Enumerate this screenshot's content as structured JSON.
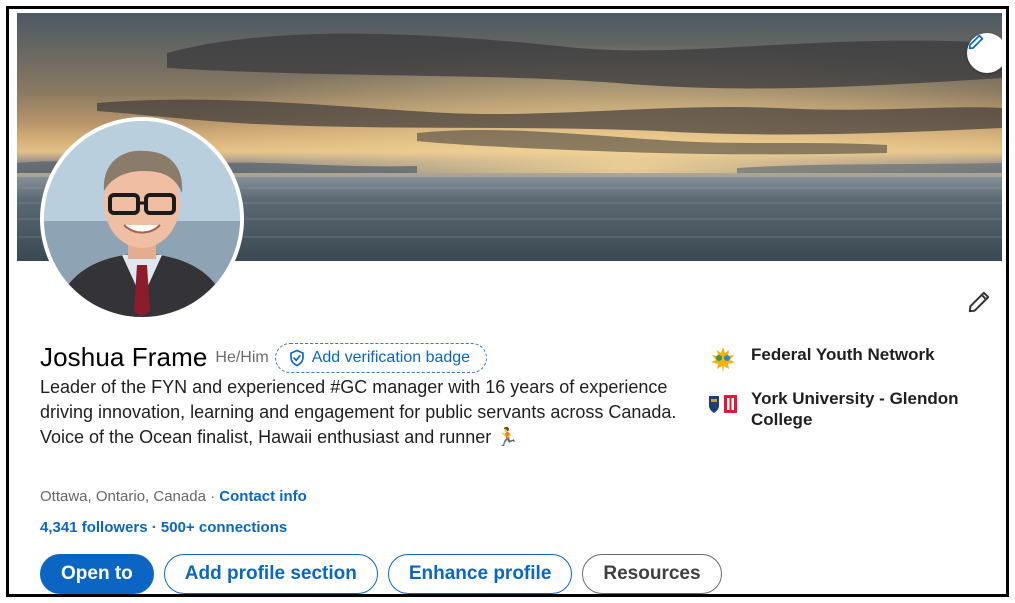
{
  "profile": {
    "name": "Joshua Frame",
    "pronouns": "He/Him",
    "verification_label": "Add verification badge",
    "headline": "Leader of the FYN and experienced #GC manager with 16 years of experience driving innovation, learning and engagement for public servants across Canada. Voice of the Ocean finalist, Hawaii enthusiast and runner",
    "headline_emoji": "🏃",
    "location": "Ottawa, Ontario, Canada",
    "location_separator": " · ",
    "contact_label": "Contact info",
    "followers": "4,341 followers",
    "connections_separator": " · ",
    "connections": "500+ connections"
  },
  "organizations": [
    {
      "name": "Federal Youth Network",
      "logo": "maple-leaf-logo-icon"
    },
    {
      "name": "York University - Glendon College",
      "logo": "university-crest-icon"
    }
  ],
  "actions": {
    "open_to": "Open to",
    "add_section": "Add profile section",
    "enhance": "Enhance profile",
    "resources": "Resources"
  },
  "colors": {
    "accent": "#0a66c2",
    "text": "#1f1f1f",
    "muted": "#666666"
  }
}
